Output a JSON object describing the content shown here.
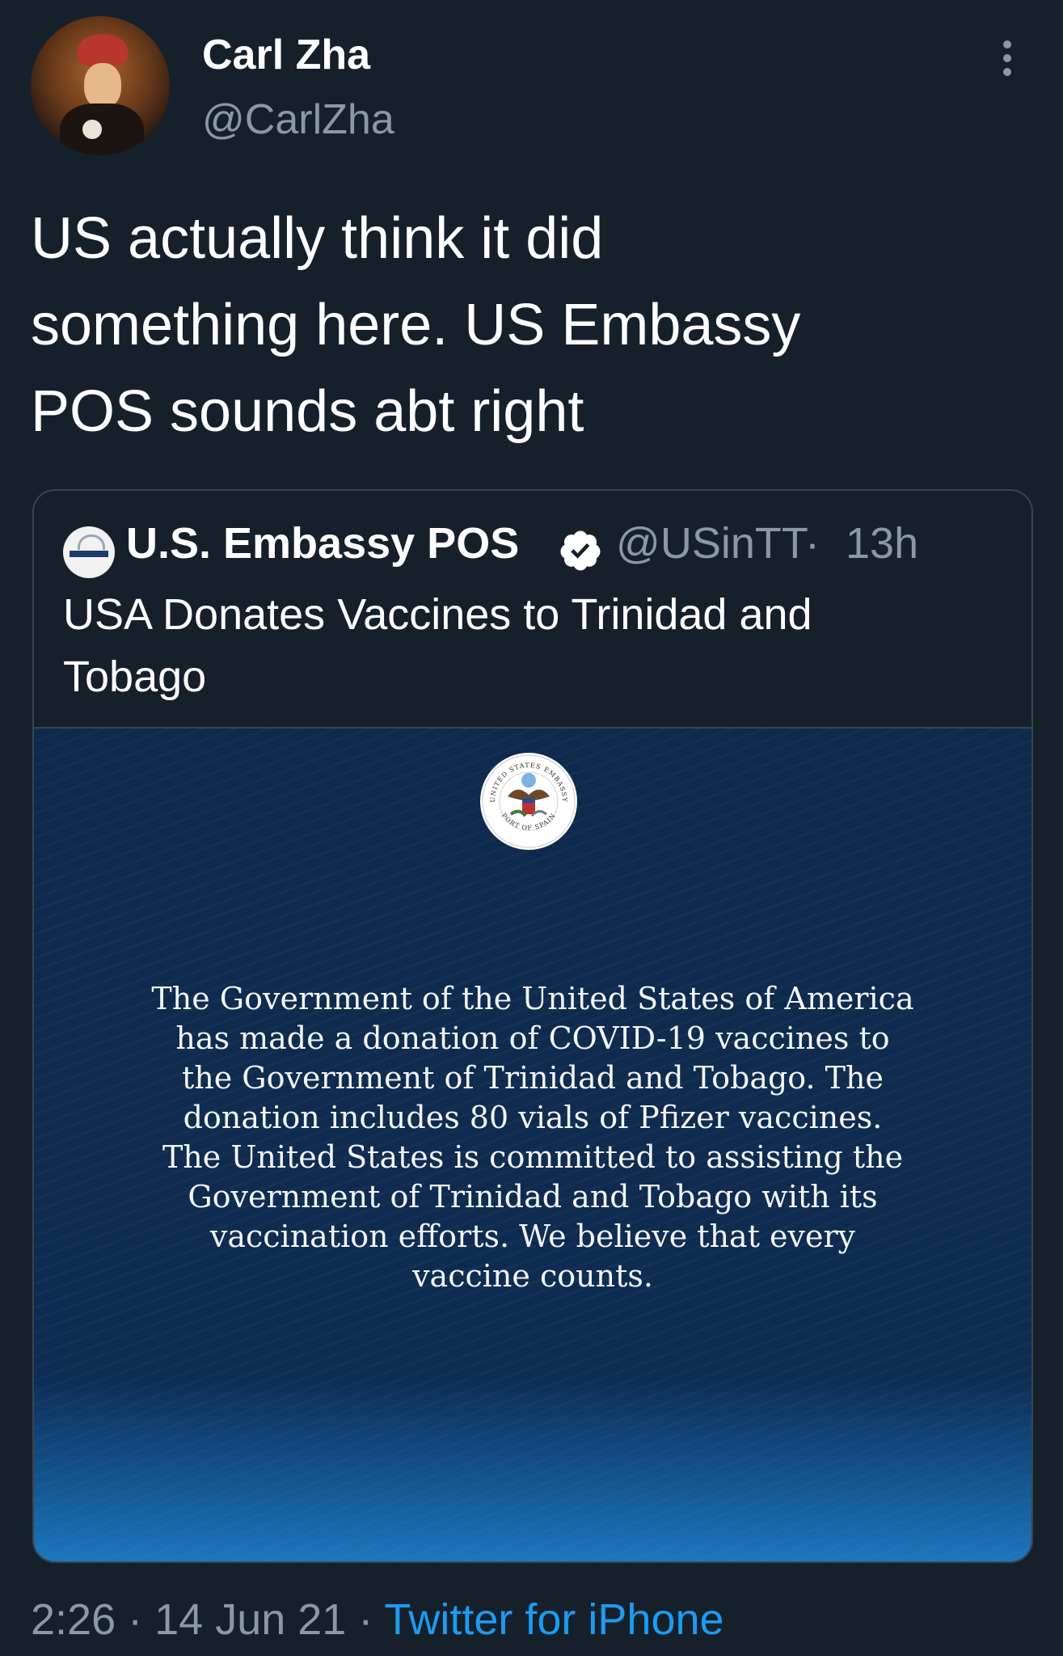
{
  "author": {
    "display_name": "Carl Zha",
    "handle": "@CarlZha"
  },
  "tweet": {
    "text_lines": [
      "US actually think it did",
      "something here. US Embassy",
      "POS sounds abt right"
    ]
  },
  "quote": {
    "display_name": "U.S. Embassy POS",
    "handle": "@USinTT",
    "separator": "·",
    "time": "13h",
    "text_lines": [
      "USA Donates Vaccines to Trinidad and",
      "Tobago"
    ],
    "image": {
      "seal_text_top": "UNITED STATES EMBASSY",
      "seal_text_bottom": "PORT OF SPAIN",
      "body_lines": [
        "The Government of the United States of America",
        "has made a donation of COVID-19 vaccines to",
        "the Government of Trinidad and Tobago. The",
        "donation includes 80 vials of Pfizer vaccines.",
        "The United States is committed to assisting the",
        "Government of Trinidad and Tobago with its",
        "vaccination efforts. We believe that every",
        "vaccine counts."
      ]
    }
  },
  "meta": {
    "time": "2:26",
    "separator": "·",
    "date": "14 Jun 21",
    "source": "Twitter for iPhone"
  },
  "colors": {
    "background": "#16202b",
    "secondary_text": "#8b98a5",
    "link": "#1d9bf0",
    "border": "#38444d"
  },
  "icons": [
    "more-vertical-icon",
    "verified-badge-icon"
  ]
}
